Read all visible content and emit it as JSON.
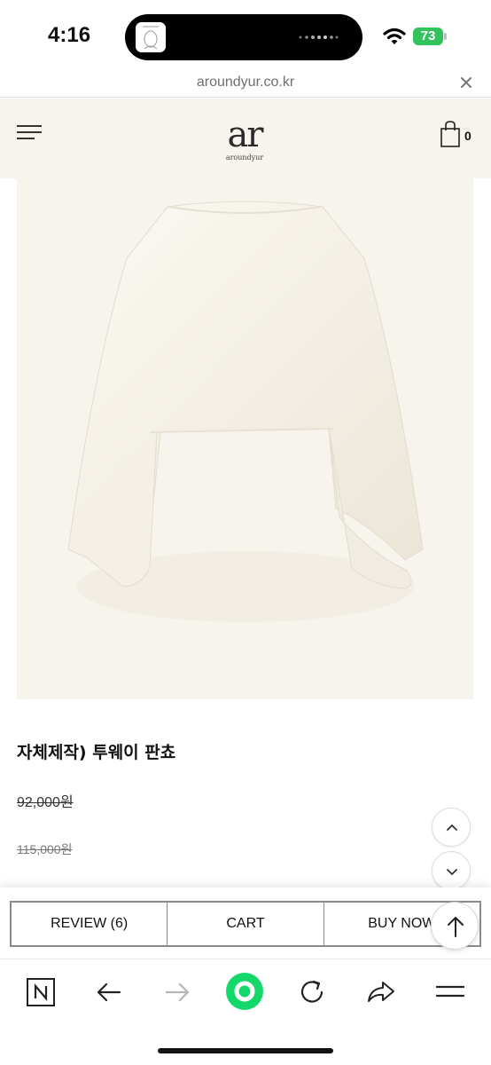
{
  "status_bar": {
    "time": "4:16",
    "battery": "73"
  },
  "url_bar": {
    "url": "aroundyur.co.kr"
  },
  "header": {
    "logo_mark": "ar",
    "logo_text": "aroundyur",
    "cart_count": "0"
  },
  "product": {
    "title": "자체제작) 투웨이 판쵸",
    "sale_price": "92,000원",
    "original_price": "115,000원"
  },
  "actions": {
    "review_label": "REVIEW (6)",
    "cart_label": "CART",
    "buy_now_label": "BUY NOW"
  },
  "colors": {
    "accent_green": "#15d86a",
    "battery_green": "#33c35c",
    "header_bg": "#f7f4ee"
  }
}
